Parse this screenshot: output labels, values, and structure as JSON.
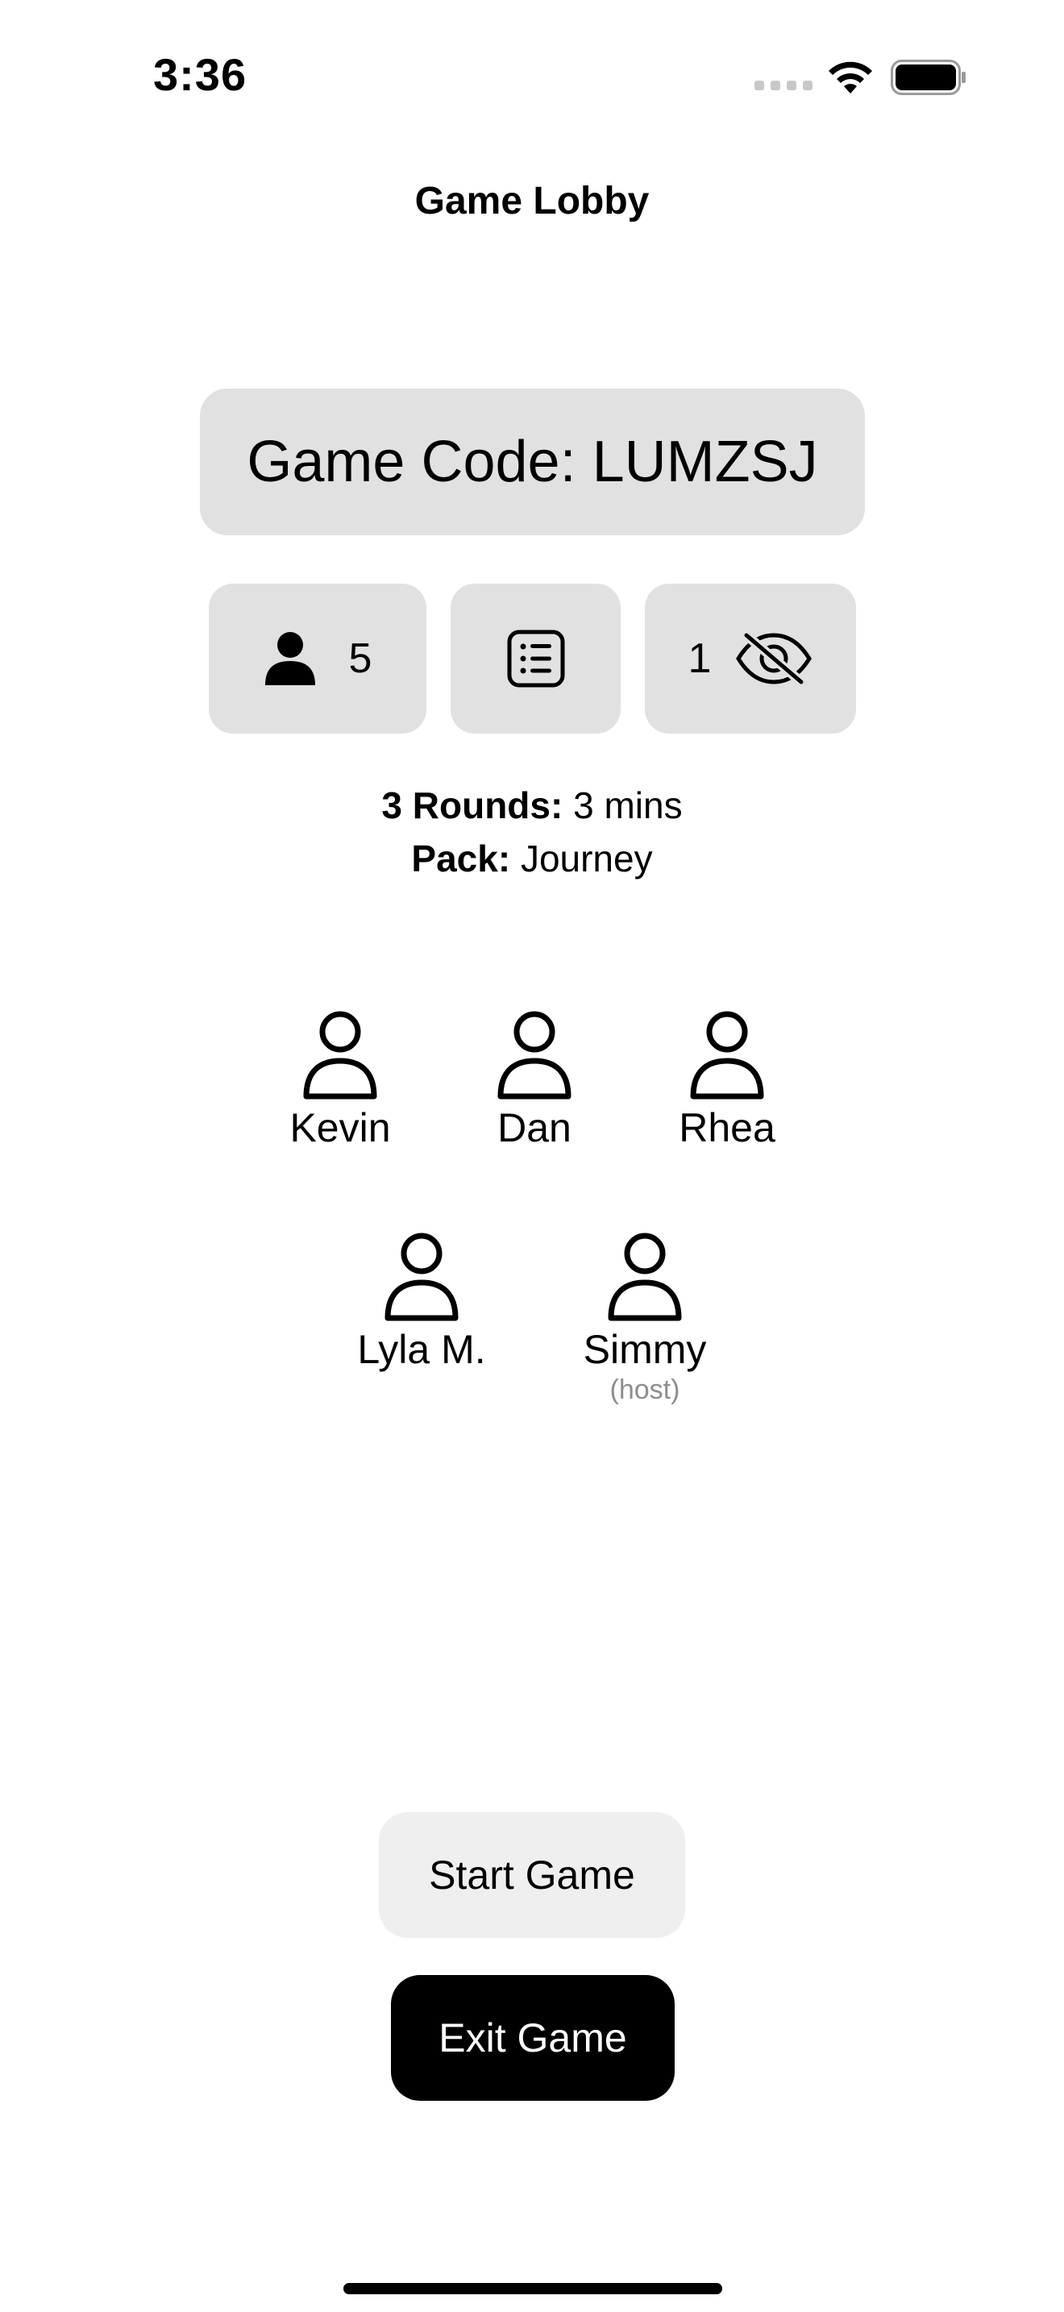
{
  "status_bar": {
    "time": "3:36"
  },
  "header": {
    "title": "Game Lobby"
  },
  "game_code": {
    "label": "Game Code: LUMZSJ"
  },
  "stats": {
    "player_count": "5",
    "hidden_count": "1",
    "icons": [
      "person-icon",
      "list-icon",
      "eye-slash-icon"
    ]
  },
  "settings": {
    "rounds_label": "3 Rounds:",
    "rounds_value": "3 mins",
    "pack_label": "Pack:",
    "pack_value": "Journey"
  },
  "players": [
    {
      "name": "Kevin"
    },
    {
      "name": "Dan"
    },
    {
      "name": "Rhea"
    },
    {
      "name": "Lyla M."
    },
    {
      "name": "Simmy",
      "role": "(host)"
    }
  ],
  "actions": {
    "start_label": "Start Game",
    "exit_label": "Exit Game"
  }
}
